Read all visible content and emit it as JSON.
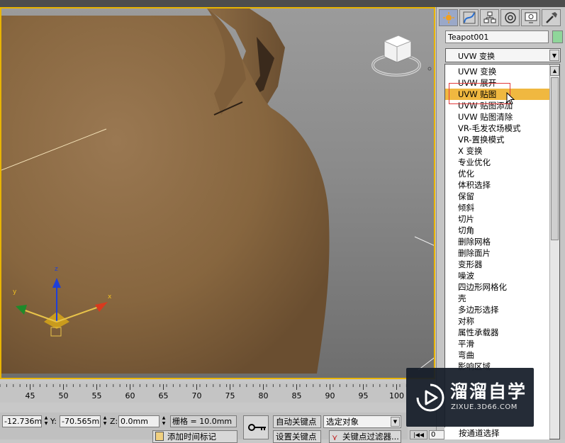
{
  "viewport": {
    "gizmo_axes": {
      "x": "x",
      "y": "y",
      "z": "z"
    }
  },
  "command_panel": {
    "tabs": [
      {
        "icon": "sun-create-icon"
      },
      {
        "icon": "modify-curve-icon"
      },
      {
        "icon": "hierarchy-icon"
      },
      {
        "icon": "motion-icon"
      },
      {
        "icon": "display-icon"
      },
      {
        "icon": "utilities-hammer-icon"
      }
    ],
    "object_name": "Teapot001",
    "swatch_color": "#8fd69a",
    "modifier_list": {
      "selected": "UVW 变换",
      "items": [
        "UVW 变换",
        "UVW 展开",
        "UVW 贴图",
        "UVW 贴图添加",
        "UVW 贴图清除",
        "VR-毛发农场模式",
        "VR-置换模式",
        "X 变换",
        "专业优化",
        "优化",
        "体积选择",
        "保留",
        "倾斜",
        "切片",
        "切角",
        "删除网格",
        "删除面片",
        "变形器",
        "噪波",
        "四边形网格化",
        "壳",
        "多边形选择",
        "对称",
        "属性承载器",
        "平滑",
        "弯曲",
        "影响区域"
      ],
      "highlighted_index": 2,
      "last_visible": "按通道选择"
    }
  },
  "timeline": {
    "ticks": [
      "45",
      "50",
      "55",
      "60",
      "65",
      "70",
      "75",
      "80",
      "85",
      "90",
      "95",
      "100"
    ]
  },
  "status": {
    "x_value": "-12.736mm",
    "y_label": "Y:",
    "y_value": "-70.565mm",
    "z_label": "Z:",
    "z_value": "0.0mm",
    "grid": "栅格 = 10.0mm",
    "auto_key": "自动关键点",
    "selection_set": "选定对象",
    "set_key": "设置关键点",
    "key_filter": "关键点过滤器...",
    "add_time_tag": "添加时间标记",
    "frame_value": "0"
  },
  "watermark": {
    "title": "溜溜自学",
    "subtitle": "ZIXUE.3D66.COM"
  },
  "colors": {
    "viewport_border": "#e8b400",
    "highlight": "#f0b840",
    "selection_box": "#e23a3a",
    "teapot": "#8b6a47"
  }
}
